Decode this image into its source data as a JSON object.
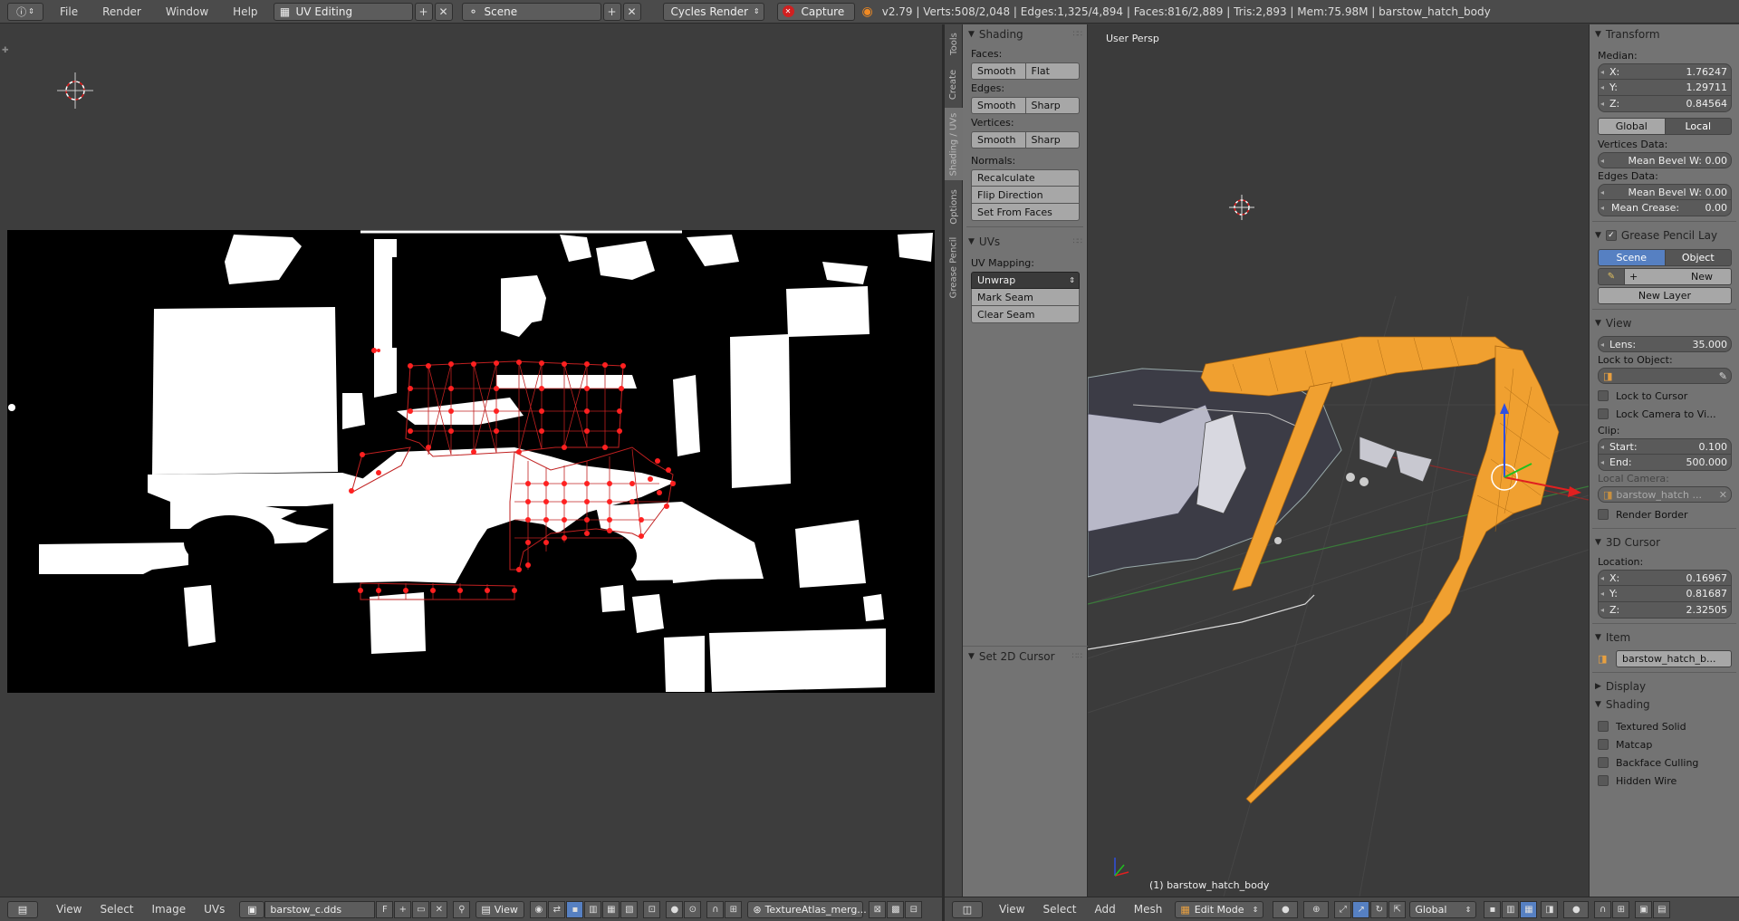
{
  "topbar": {
    "info_icon": "info-icon",
    "menus": [
      "File",
      "Render",
      "Window",
      "Help"
    ],
    "layout_name": "UV Editing",
    "scene_name": "Scene",
    "render_engine": "Cycles Render",
    "capture_label": "Capture",
    "stats": "v2.79 | Verts:508/2,048 | Edges:1,325/4,894 | Faces:816/2,889 | Tris:2,893 | Mem:75.98M | barstow_hatch_body"
  },
  "toolshelf": {
    "tabs": [
      "Tools",
      "Create",
      "Shading / UVs",
      "Options",
      "Grease Pencil"
    ],
    "shading": {
      "title": "Shading",
      "faces_label": "Faces:",
      "edges_label": "Edges:",
      "vertices_label": "Vertices:",
      "smooth": "Smooth",
      "flat": "Flat",
      "sharp": "Sharp",
      "normals_label": "Normals:",
      "recalculate": "Recalculate",
      "flip_direction": "Flip Direction",
      "set_from_faces": "Set From Faces"
    },
    "uvs": {
      "title": "UVs",
      "mapping_label": "UV Mapping:",
      "unwrap": "Unwrap",
      "mark_seam": "Mark Seam",
      "clear_seam": "Clear Seam"
    },
    "set_2d_cursor": "Set 2D Cursor"
  },
  "viewport": {
    "title": "User Persp",
    "object_label": "(1) barstow_hatch_body"
  },
  "nprops": {
    "transform": {
      "title": "Transform",
      "median_label": "Median:",
      "x": "1.76247",
      "y": "1.29711",
      "z": "0.84564",
      "global": "Global",
      "local": "Local",
      "vertices_data": "Vertices Data:",
      "mean_bevel_w_v": "Mean Bevel W: 0.00",
      "edges_data": "Edges Data:",
      "mean_bevel_w_e": "Mean Bevel W: 0.00",
      "mean_crease_label": "Mean Crease:",
      "mean_crease": "0.00"
    },
    "grease": {
      "title": "Grease Pencil Lay",
      "scene": "Scene",
      "object": "Object",
      "new": "New",
      "new_layer": "New Layer"
    },
    "view": {
      "title": "View",
      "lens_label": "Lens:",
      "lens": "35.000",
      "lock_to_object": "Lock to Object:",
      "lock_to_cursor": "Lock to Cursor",
      "lock_camera": "Lock Camera to Vi...",
      "clip_label": "Clip:",
      "start_label": "Start:",
      "start": "0.100",
      "end_label": "End:",
      "end": "500.000",
      "local_camera": "Local Camera:",
      "camera_name": "barstow_hatch ...",
      "render_border": "Render Border"
    },
    "cursor": {
      "title": "3D Cursor",
      "location_label": "Location:",
      "x": "0.16967",
      "y": "0.81687",
      "z": "2.32505"
    },
    "item": {
      "title": "Item",
      "name": "barstow_hatch_b..."
    },
    "display": {
      "title": "Display"
    },
    "shading": {
      "title": "Shading",
      "textured_solid": "Textured Solid",
      "matcap": "Matcap",
      "backface_culling": "Backface Culling",
      "hidden_wire": "Hidden Wire"
    },
    "x_label": "X:",
    "y_label": "Y:",
    "z_label": "Z:"
  },
  "uv_bottombar": {
    "menus": [
      "View",
      "Select",
      "Image",
      "UVs"
    ],
    "image_name": "barstow_c.dds",
    "fake_user": "F",
    "view_mode": "View",
    "uv_map": "TextureAtlas_merg..."
  },
  "vp_bottombar": {
    "menus": [
      "View",
      "Select",
      "Add",
      "Mesh"
    ],
    "mode": "Edit Mode",
    "orientation": "Global"
  },
  "colors": {
    "selection_orange": "#f0a030",
    "uv_red": "#ff2020",
    "active_blue": "#5680c2"
  }
}
